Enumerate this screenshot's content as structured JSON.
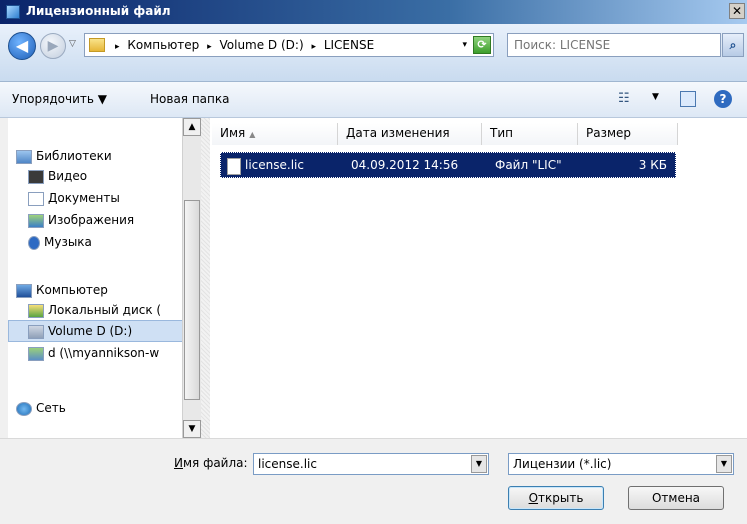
{
  "window": {
    "title": "Лицензионный файл",
    "close_glyph": "✕"
  },
  "nav": {
    "back_glyph": "◀",
    "forward_glyph": "▶",
    "history_glyph": "▽",
    "breadcrumbs": [
      "Компьютер",
      "Volume D (D:)",
      "LICENSE"
    ],
    "crumb_sep": "▸",
    "dropdown_glyph": "▾",
    "refresh_glyph": "⟳",
    "search_placeholder": "Поиск: LICENSE",
    "search_glyph": "⌕"
  },
  "toolbar": {
    "organize_label": "Упорядочить ▼",
    "new_folder_label": "Новая папка",
    "views_glyph": "☷",
    "views_arrow": "▼",
    "help_glyph": "?"
  },
  "navpane": {
    "libraries_label": "Библиотеки",
    "video_label": "Видео",
    "documents_label": "Документы",
    "images_label": "Изображения",
    "music_label": "Музыка",
    "computer_label": "Компьютер",
    "local_disk_label": "Локальный диск (",
    "volume_d_label": "Volume D (D:)",
    "network_drive_label": "d (\\\\myannikson-w",
    "network_label": "Сеть",
    "scroll_up": "▲",
    "scroll_down": "▼"
  },
  "filelist": {
    "columns": {
      "name": "Имя",
      "date": "Дата изменения",
      "type": "Тип",
      "size": "Размер"
    },
    "sort_glyph": "▲",
    "rows": [
      {
        "name": "license.lic",
        "date": "04.09.2012 14:56",
        "type": "Файл \"LIC\"",
        "size": "3 КБ"
      }
    ]
  },
  "bottom": {
    "filename_label_prefix": "И",
    "filename_label_rest": "мя файла:",
    "filename_value": "license.lic",
    "filter_value": "Лицензии (*.lic)",
    "combo_glyph": "▼",
    "open_label_u": "О",
    "open_label_rest": "ткрыть",
    "cancel_label": "Отмена"
  }
}
